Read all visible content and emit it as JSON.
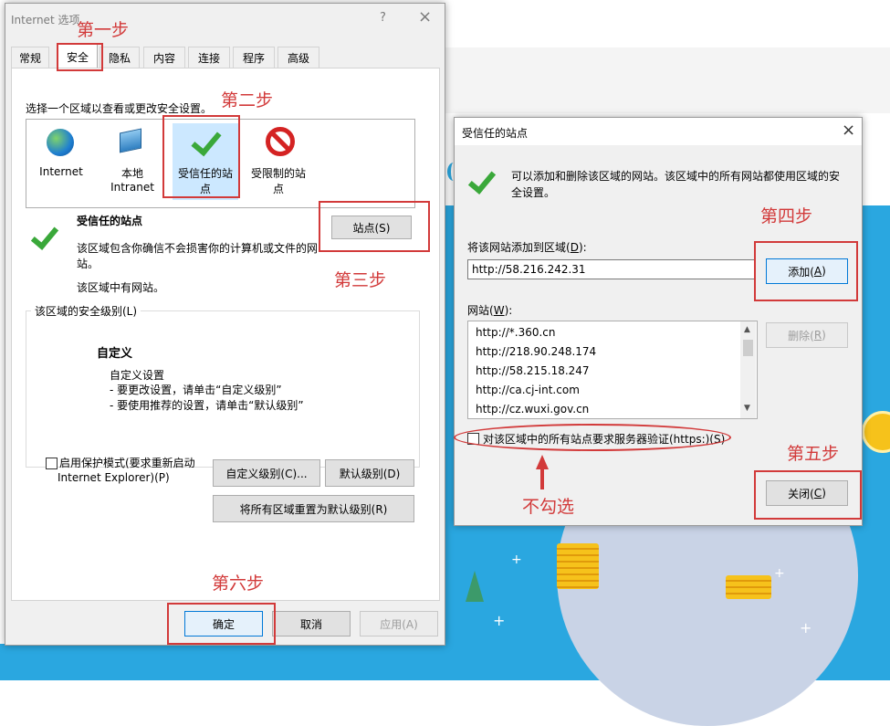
{
  "main_dialog": {
    "title": "Internet 选项",
    "help_label": "?",
    "close_label": "×",
    "tabs": [
      "常规",
      "安全",
      "隐私",
      "内容",
      "连接",
      "程序",
      "高级"
    ],
    "zone_prompt": "选择一个区域以查看或更改安全设置。",
    "zones": [
      {
        "line1": "Internet",
        "line2": ""
      },
      {
        "line1": "本地",
        "line2": "Intranet"
      },
      {
        "line1": "受信任的站",
        "line2": "点"
      },
      {
        "line1": "受限制的站",
        "line2": "点"
      }
    ],
    "selected_zone_title": "受信任的站点",
    "zone_desc_1": "该区域包含你确信不会损害你的计算机或文件的网",
    "zone_desc_2": "站。",
    "zone_desc_3": "该区域中有网站。",
    "sites_button": "站点(S)",
    "security_level_label": "该区域的安全级别(L)",
    "custom_title": "自定义",
    "custom_line1": "自定义设置",
    "custom_line2": "- 要更改设置，请单击“自定义级别”",
    "custom_line3": "- 要使用推荐的设置，请单击“默认级别”",
    "protected_mode_line1": "启用保护模式(要求重新启动",
    "protected_mode_line2": "Internet Explorer)(P)",
    "custom_level_button": "自定义级别(C)...",
    "default_level_button": "默认级别(D)",
    "reset_all_button": "将所有区域重置为默认级别(R)",
    "ok_button": "确定",
    "cancel_button": "取消",
    "apply_button": "应用(A)"
  },
  "trusted_dialog": {
    "title": "受信任的站点",
    "close_label": "×",
    "info_line1": "可以添加和删除该区域的网站。该区域中的所有网站都使用区域的安",
    "info_line2": "全设置。",
    "add_label_text": "将该网站添加到区域(",
    "add_label_key": "D",
    "add_label_end": "):",
    "url_value": "http://58.216.242.31",
    "add_button_text": "添加(",
    "add_button_key": "A",
    "add_button_end": ")",
    "websites_label_text": "网站(",
    "websites_label_key": "W",
    "websites_label_end": "):",
    "websites": [
      "http://*.360.cn",
      "http://218.90.248.174",
      "http://58.215.18.247",
      "http://ca.cj-int.com",
      "http://cz.wuxi.gov.cn"
    ],
    "remove_button_text": "删除(",
    "remove_button_key": "R",
    "remove_button_end": ")",
    "https_checkbox_label": "对该区域中的所有站点要求服务器验证(https:)(S)",
    "close_button_text": "关闭(",
    "close_button_key": "C",
    "close_button_end": ")"
  },
  "annotations": {
    "step1": "第一步",
    "step2": "第二步",
    "step3": "第三步",
    "step4": "第四步",
    "step5": "第五步",
    "step6": "第六步",
    "uncheck_note": "不勾选"
  },
  "colors": {
    "annotation_red": "#d23a3a",
    "dialog_bg": "#f0f0f0",
    "scene_blue": "#2aa7e0",
    "check_green": "#3aa83a"
  }
}
